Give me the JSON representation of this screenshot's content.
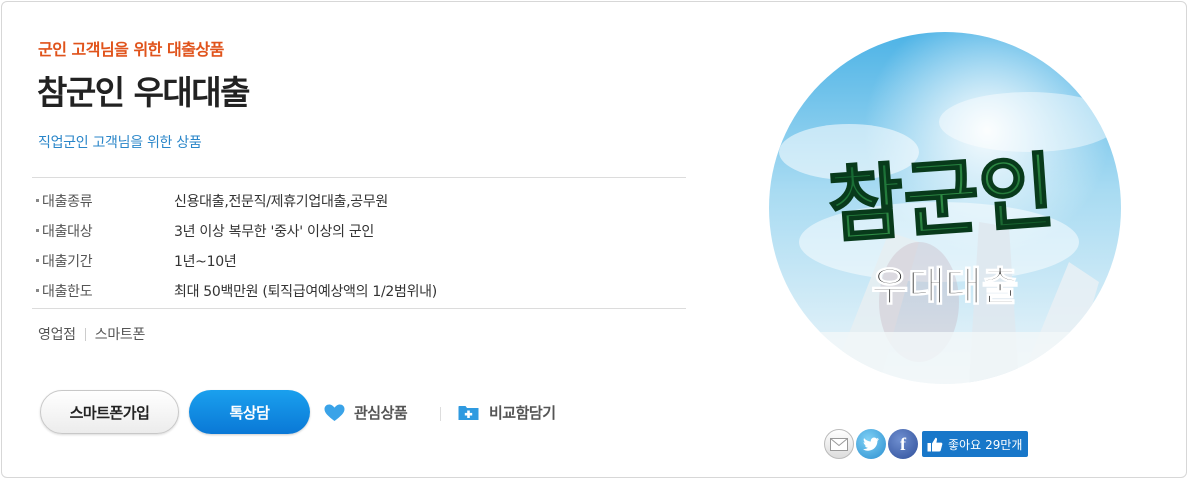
{
  "product": {
    "eyebrow": "군인 고객님을 위한 대출상품",
    "title": "참군인 우대대출",
    "subtitle": "직업군인 고객님을 위한 상품"
  },
  "info_rows": [
    {
      "label": "대출종류",
      "value": "신용대출,전문직/제휴기업대출,공무원"
    },
    {
      "label": "대출대상",
      "value": "3년 이상 복무한 '중사' 이상의 군인"
    },
    {
      "label": "대출기간",
      "value": "1년~10년"
    },
    {
      "label": "대출한도",
      "value": "최대 50백만원 (퇴직급여예상액의 1/2범위내)"
    }
  ],
  "channels": [
    "영업점",
    "스마트폰"
  ],
  "actions": {
    "smartphone_join": "스마트폰가입",
    "talk_consult": "톡상담",
    "favorite": "관심상품",
    "compare": "비교함담기"
  },
  "hero": {
    "line1": "참군인",
    "line2": "우대대출"
  },
  "share": {
    "like_label": "좋아요",
    "like_count": "29만개"
  },
  "colors": {
    "eyebrow": "#e0531b",
    "subtitle": "#2a86c9",
    "talk_button": "#0a78d6",
    "like_button": "#1877c9"
  },
  "icons": {
    "favorite": "heart-icon",
    "compare": "folder-plus-icon",
    "mail": "mail-icon",
    "twitter": "twitter-icon",
    "facebook": "facebook-icon",
    "like": "thumbs-up-icon"
  }
}
